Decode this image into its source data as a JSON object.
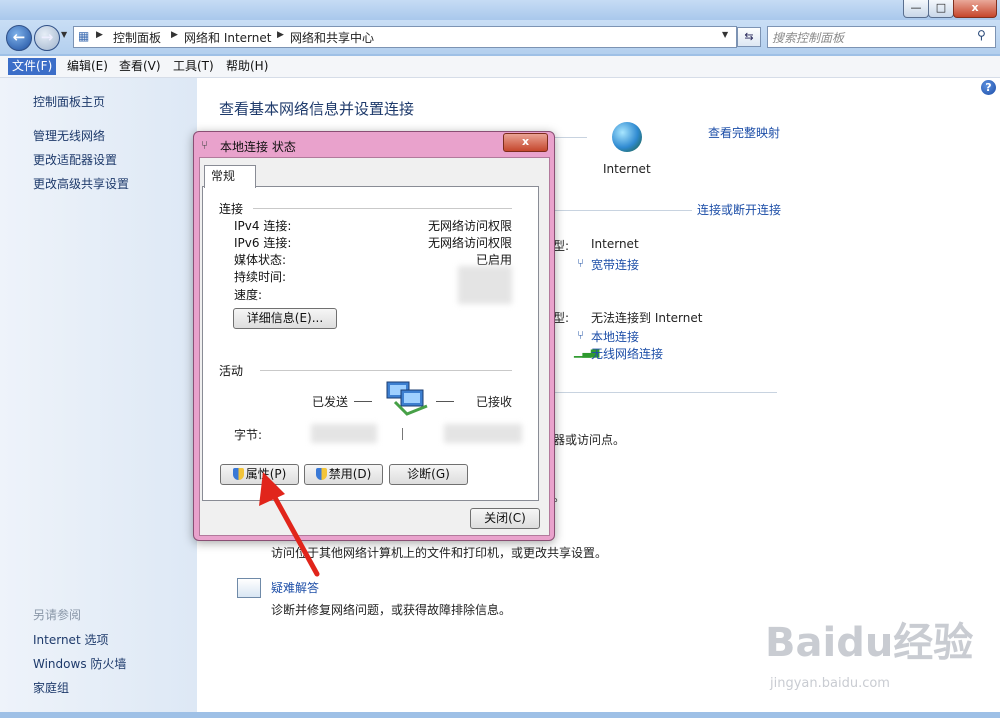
{
  "window": {
    "min_glyph": "—",
    "max_glyph": "□",
    "close_glyph": "x"
  },
  "nav": {
    "breadcrumbs": [
      "控制面板",
      "网络和 Internet",
      "网络和共享中心"
    ],
    "search_placeholder": "搜索控制面板"
  },
  "menu": {
    "items": [
      "文件(F)",
      "编辑(E)",
      "查看(V)",
      "工具(T)",
      "帮助(H)"
    ]
  },
  "sidebar": {
    "home": "控制面板主页",
    "links": [
      "管理无线网络",
      "更改适配器设置",
      "更改高级共享设置"
    ],
    "see_also_title": "另请参阅",
    "see_also": [
      "Internet 选项",
      "Windows 防火墙",
      "家庭组"
    ]
  },
  "main": {
    "title": "查看基本网络信息并设置连接",
    "view_full_map": "查看完整映射",
    "internet_label": "Internet",
    "connect_disconnect": "连接或断开连接",
    "access_type_1": "Internet",
    "conn_1": "宽带连接",
    "access_type_2": "无法连接到 Internet",
    "conn_2": "本地连接",
    "conn_3": "无线网络连接",
    "frag_type_1": "型:",
    "frag_type_2": "型:",
    "frag_router": "器或访问点。",
    "frag_period": "。",
    "share_desc": "访问位于其他网络计算机上的文件和打印机，或更改共享设置。",
    "troubleshoot_link": "疑难解答",
    "troubleshoot_desc": "诊断并修复网络问题，或获得故障排除信息。"
  },
  "dialog": {
    "title": "本地连接 状态",
    "close_glyph": "x",
    "tab": "常规",
    "connection_group": "连接",
    "fields": [
      {
        "label": "IPv4 连接:",
        "value": "无网络访问权限"
      },
      {
        "label": "IPv6 连接:",
        "value": "无网络访问权限"
      },
      {
        "label": "媒体状态:",
        "value": "已启用"
      },
      {
        "label": "持续时间:",
        "value": ""
      },
      {
        "label": "速度:",
        "value": ""
      }
    ],
    "details_button": "详细信息(E)...",
    "activity_group": "活动",
    "sent_label": "已发送",
    "received_label": "已接收",
    "bytes_label": "字节:",
    "properties_button": "属性(P)",
    "disable_button": "禁用(D)",
    "diagnose_button": "诊断(G)",
    "close_button": "关闭(C)"
  },
  "watermark": {
    "brand": "Baidu经验",
    "url": "jingyan.baidu.com"
  }
}
